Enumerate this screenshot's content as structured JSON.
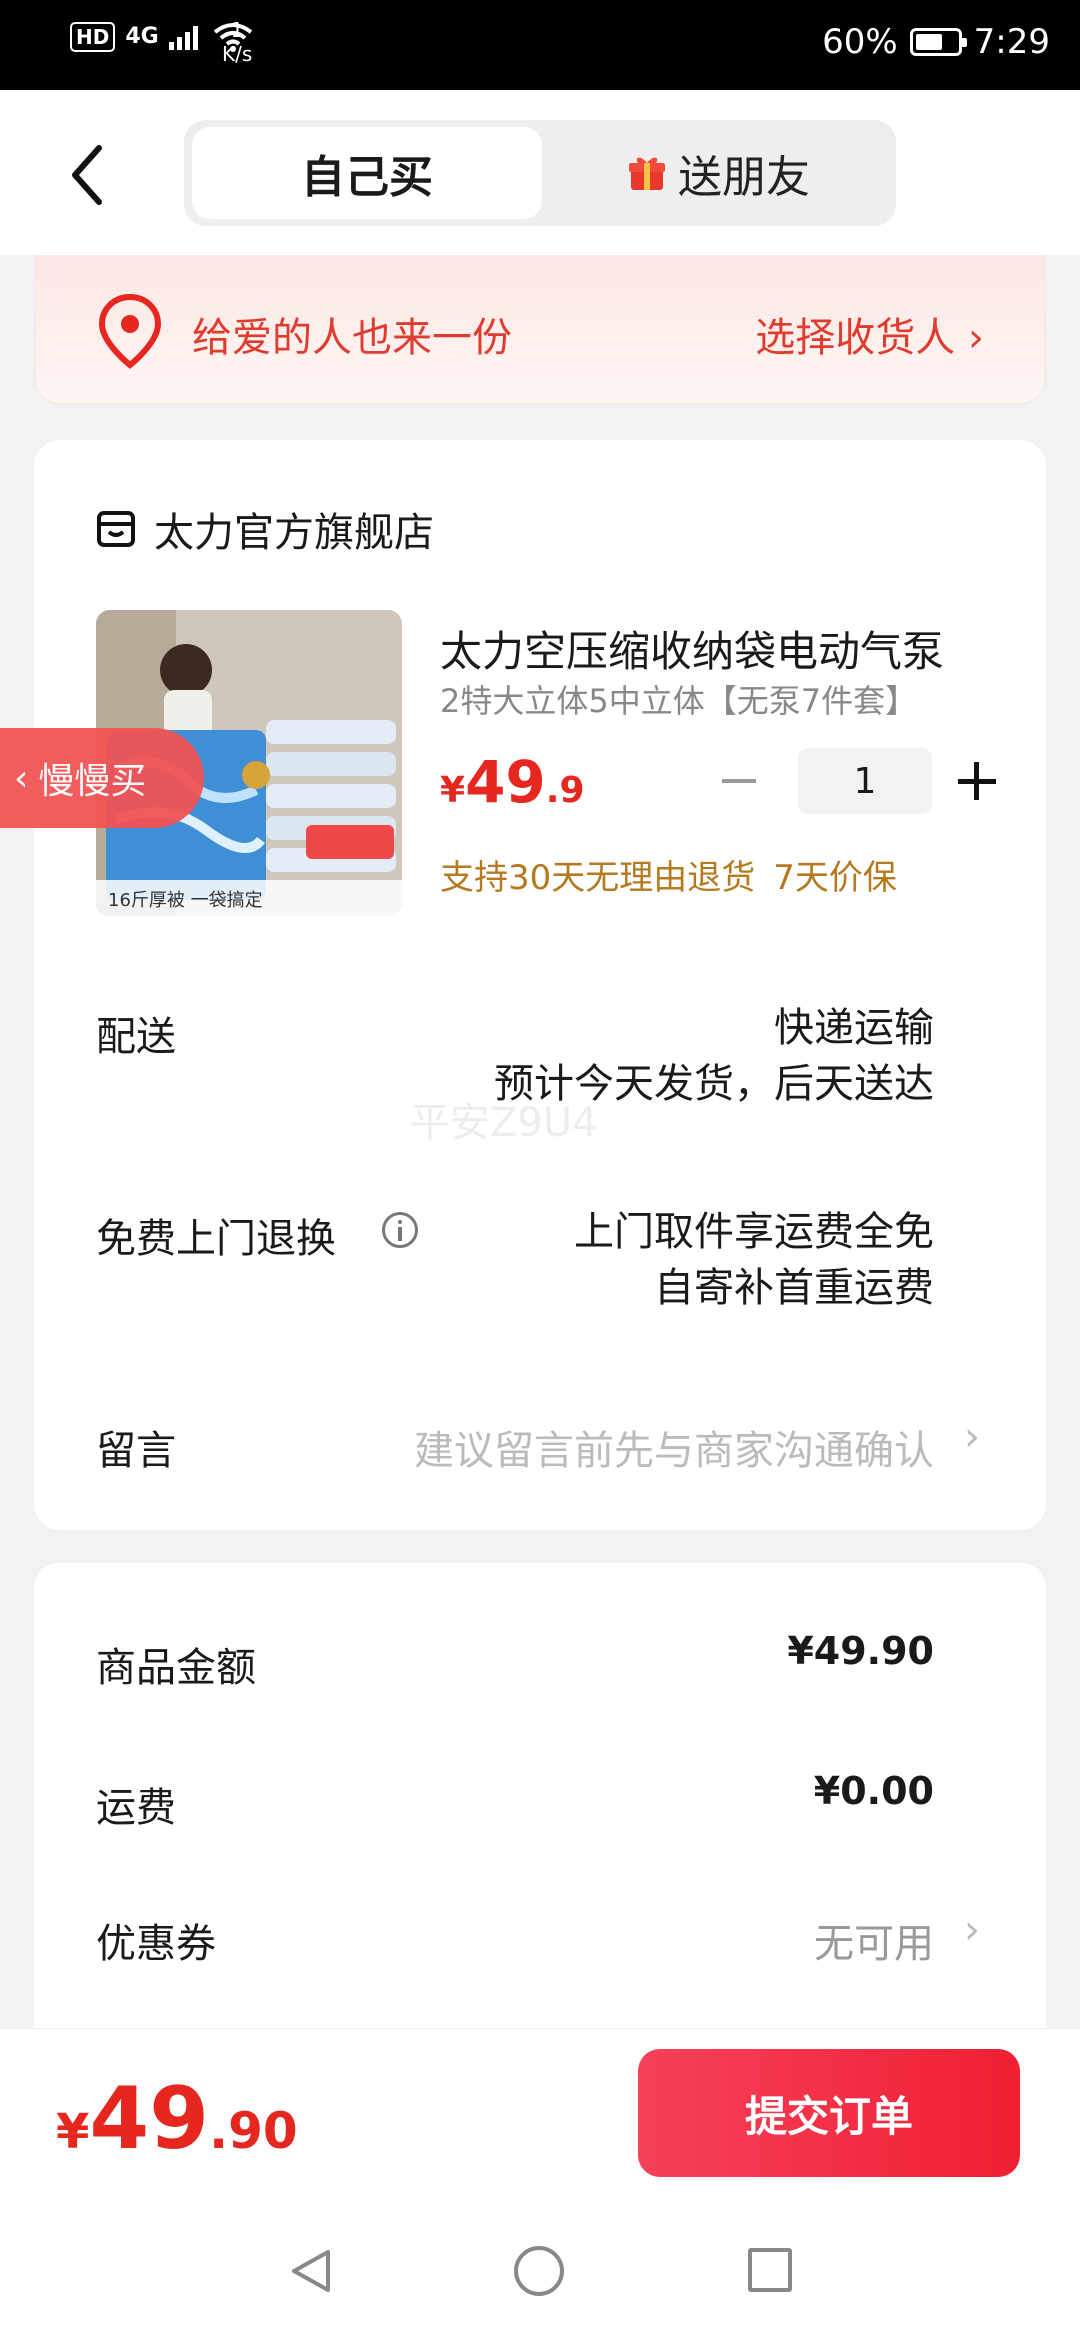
{
  "status_bar": {
    "hd": "HD",
    "network": "4G",
    "speed_value": "1",
    "speed_unit": "K/s",
    "battery": "60%",
    "time": "7:29"
  },
  "header": {
    "tab_self": "自己买",
    "tab_friend": "送朋友"
  },
  "banner": {
    "text": "给爱的人也来一份",
    "link": "选择收货人"
  },
  "order": {
    "shop_name": "太力官方旗舰店",
    "product": {
      "title": "太力空压缩收纳袋电动气泵",
      "spec": "2特大立体5中立体【无泵7件套】",
      "image_caption": "16斤厚被 一袋搞定",
      "price_currency": "¥",
      "price_int": "49",
      "price_dec": ".9",
      "quantity": "1",
      "service_return": "支持30天无理由退货",
      "service_price": "7天价保"
    },
    "delivery_label": "配送",
    "delivery_method": "快递运输",
    "delivery_estimate": "预计今天发货，后天送达",
    "return_label": "免费上门退换",
    "return_line1": "上门取件享运费全免",
    "return_line2": "自寄补首重运费",
    "remark_label": "留言",
    "remark_placeholder": "建议留言前先与商家沟通确认"
  },
  "watermark": "平安Z9U4",
  "slow_buy": "慢慢买",
  "summary": {
    "goods_label": "商品金额",
    "goods_value": "¥49.90",
    "shipping_label": "运费",
    "shipping_value": "¥0.00",
    "coupon_label": "优惠券",
    "coupon_value": "无可用"
  },
  "bottom": {
    "currency": "¥",
    "total_int": "49",
    "total_dec": ".90",
    "submit": "提交订单"
  },
  "colors": {
    "accent": "#e5271f",
    "service_tag": "#b5791f",
    "submit_gradient_start": "#f5415a",
    "submit_gradient_end": "#f01f33"
  }
}
